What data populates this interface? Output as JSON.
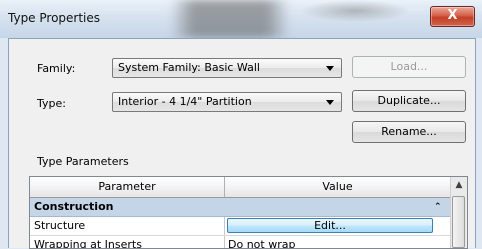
{
  "window": {
    "title": "Type Properties",
    "close_glyph": "X"
  },
  "form": {
    "family_label": "Family:",
    "family_value": "System Family: Basic Wall",
    "type_label": "Type:",
    "type_value": "Interior - 4 1/4\" Partition",
    "load_label": "Load...",
    "duplicate_label": "Duplicate...",
    "rename_label": "Rename..."
  },
  "parameters": {
    "section_label": "Type Parameters",
    "columns": [
      "Parameter",
      "Value"
    ],
    "group": "Construction",
    "collapse_glyph": "⌃",
    "rows": [
      {
        "parameter": "Structure",
        "value": "Edit..."
      },
      {
        "parameter": "Wrapping at Inserts",
        "value": "Do not wrap"
      }
    ]
  },
  "icons": [
    "close-icon",
    "dropdown-arrow-icon",
    "collapse-icon",
    "scroll-up-icon"
  ]
}
